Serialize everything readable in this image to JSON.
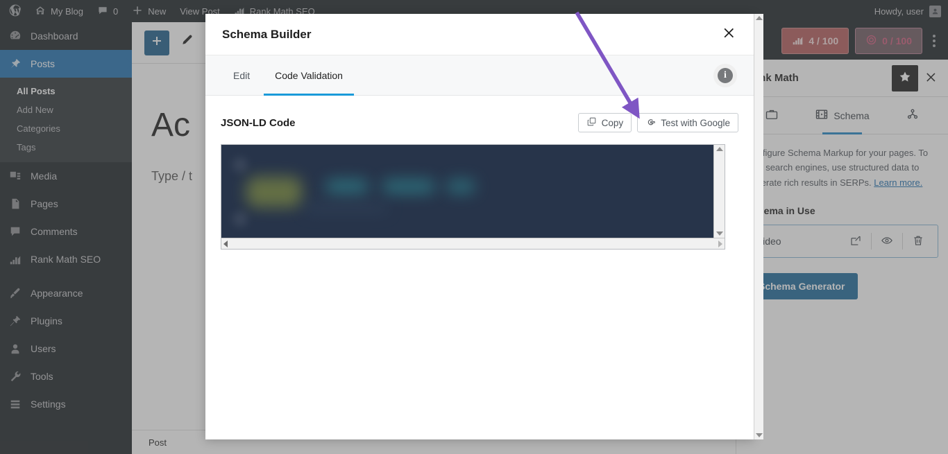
{
  "adminbar": {
    "logo_icon": "wordpress-logo-icon",
    "site_name": "My Blog",
    "site_icon": "home-icon",
    "comments_icon": "comment-bubble-icon",
    "comments_count": "0",
    "new_icon": "plus-icon",
    "new_label": "New",
    "view_post_label": "View Post",
    "rank_math_icon": "rank-math-icon",
    "rank_math_label": "Rank Math SEO",
    "howdy": "Howdy, user"
  },
  "sidebar": {
    "items": [
      {
        "label": "Dashboard",
        "icon": "dashboard-icon"
      },
      {
        "label": "Posts",
        "icon": "pin-icon",
        "current": true
      },
      {
        "label": "Media",
        "icon": "media-icon"
      },
      {
        "label": "Pages",
        "icon": "pages-icon"
      },
      {
        "label": "Comments",
        "icon": "comments-icon"
      },
      {
        "label": "Rank Math SEO",
        "icon": "rank-math-icon"
      },
      {
        "label": "Appearance",
        "icon": "appearance-brush-icon"
      },
      {
        "label": "Plugins",
        "icon": "plugin-icon"
      },
      {
        "label": "Users",
        "icon": "users-icon"
      },
      {
        "label": "Tools",
        "icon": "wrench-icon"
      },
      {
        "label": "Settings",
        "icon": "settings-gear-icon"
      }
    ],
    "submenu": [
      {
        "label": "All Posts",
        "current": true
      },
      {
        "label": "Add New"
      },
      {
        "label": "Categories"
      },
      {
        "label": "Tags"
      }
    ]
  },
  "editor": {
    "inserter_icon": "plus-icon",
    "tools_icon": "pencil-icon",
    "post_title": "Ac",
    "block_placeholder": "Type / t",
    "footer_breadcrumb": "Post"
  },
  "rank_math_panel": {
    "score_seo": "4 / 100",
    "score_seo_icon": "rank-math-icon",
    "score_ai": "0 / 100",
    "score_ai_icon": "content-ai-icon",
    "more_icon": "kebab-menu-icon",
    "title": "Rank Math",
    "star_icon": "star-icon",
    "close_icon": "close-icon",
    "tabs": [
      {
        "label": "",
        "icon": "briefcase-icon",
        "active": false
      },
      {
        "label": "Schema",
        "icon": "film-schema-icon",
        "active": true
      },
      {
        "label": "",
        "icon": "social-share-icon",
        "active": false
      }
    ],
    "description": "Configure Schema Markup for your pages. To help search engines, use structured data to generate rich results in SERPs.",
    "learn_more": "Learn more.",
    "section_title": "Schema in Use",
    "schema_item": "Video",
    "schema_item_actions": [
      {
        "icon": "edit-square-icon"
      },
      {
        "icon": "eye-preview-icon"
      },
      {
        "icon": "trash-delete-icon"
      }
    ],
    "generator_button": "Schema Generator"
  },
  "modal": {
    "title": "Schema Builder",
    "close_icon": "close-icon",
    "tabs": [
      {
        "label": "Edit",
        "active": false
      },
      {
        "label": "Code Validation",
        "active": true
      }
    ],
    "info_icon": "info-icon",
    "code_label": "JSON-LD Code",
    "copy_button": "Copy",
    "copy_icon": "copy-icon",
    "test_button": "Test with Google",
    "test_icon": "google-g-icon",
    "code_content_redacted": true
  },
  "annotation": {
    "arrow_color": "#7f56c4",
    "points_to": "test-with-google-button"
  },
  "colors": {
    "wp_dark": "#1d2327",
    "wp_blue": "#2271b1",
    "tab_accent": "#1a9ad9",
    "code_bg": "#27344a",
    "score_red": "#b45b5b",
    "generator_blue": "#1e6a9c"
  }
}
